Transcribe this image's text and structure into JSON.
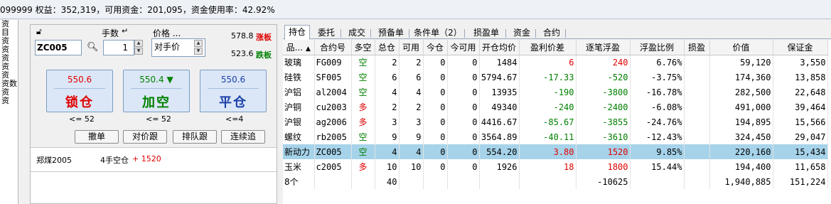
{
  "topbar": {
    "text": "099999 权益：352,319，可用资金：201,095，资金使用率：42.92%"
  },
  "left_strip": {
    "items": [
      "资",
      "",
      "目",
      "",
      "",
      "资",
      "资",
      "资",
      "资",
      "资",
      "资数",
      "资",
      "资"
    ]
  },
  "order": {
    "lot_label": "手数",
    "price_label": "价格 ...",
    "code": "ZC005",
    "qty": "1",
    "price_type": "对手价",
    "limit_up": {
      "value": "578.8",
      "label": "涨板"
    },
    "limit_down": {
      "value": "523.6",
      "label": "跌板"
    },
    "buttons": [
      {
        "price": "550.6",
        "title": "锁仓",
        "arrow": "",
        "price_color": "#e00000",
        "title_color": "#e00000",
        "under": "<= 52"
      },
      {
        "price": "550.4",
        "title": "加空",
        "arrow": "▼",
        "price_color": "#008000",
        "title_color": "#008000",
        "under": "<= 52"
      },
      {
        "price": "550.6",
        "title": "平仓",
        "arrow": "",
        "price_color": "#1a3fa8",
        "title_color": "#1a3fa8",
        "under": "<=4"
      }
    ],
    "actions": [
      "撤单",
      "对价跟",
      "排队跟",
      "连续追"
    ],
    "position_line": {
      "contract": "郑煤2005",
      "desc": "4手空仓",
      "pnl": "+ 1520"
    }
  },
  "tabs": [
    "持仓",
    "委托",
    "成交",
    "预备单",
    "条件单（2）",
    "损盈单",
    "资金",
    "合约"
  ],
  "active_tab": 0,
  "grid": {
    "headers": [
      "品...",
      "合约号",
      "多空",
      "总仓",
      "可用",
      "今仓",
      "今可用",
      "开仓均价",
      "盈利价差",
      "逐笔浮盈",
      "浮盈比例",
      "损盈",
      "价值",
      "保证金"
    ],
    "rows": [
      [
        "玻璃",
        "FG009",
        "空",
        "2",
        "2",
        "0",
        "0",
        "1484",
        "6",
        "240",
        "6.76%",
        "",
        "59,120",
        "3,550"
      ],
      [
        "硅铁",
        "SF005",
        "空",
        "6",
        "6",
        "0",
        "0",
        "5794.67",
        "-17.33",
        "-520",
        "-3.75%",
        "",
        "174,360",
        "13,858"
      ],
      [
        "沪铝",
        "al2004",
        "空",
        "4",
        "4",
        "0",
        "0",
        "13935",
        "-190",
        "-3800",
        "-16.78%",
        "",
        "282,500",
        "22,648"
      ],
      [
        "沪铜",
        "cu2003",
        "多",
        "2",
        "2",
        "0",
        "0",
        "49340",
        "-240",
        "-2400",
        "-6.08%",
        "",
        "491,000",
        "39,464"
      ],
      [
        "沪银",
        "ag2006",
        "多",
        "3",
        "3",
        "0",
        "0",
        "4416.67",
        "-85.67",
        "-3855",
        "-24.76%",
        "",
        "194,895",
        "15,566"
      ],
      [
        "螺纹",
        "rb2005",
        "空",
        "9",
        "9",
        "0",
        "0",
        "3564.89",
        "-40.11",
        "-3610",
        "-12.43%",
        "",
        "324,450",
        "29,047"
      ],
      [
        "新动力",
        "ZC005",
        "空",
        "4",
        "4",
        "0",
        "0",
        "554.20",
        "3.80",
        "1520",
        "9.85%",
        "",
        "220,160",
        "15,434"
      ],
      [
        "玉米",
        "c2005",
        "多",
        "10",
        "10",
        "0",
        "0",
        "1926",
        "18",
        "1800",
        "15.44%",
        "",
        "194,400",
        "11,658"
      ],
      [
        "8个",
        "",
        "",
        "40",
        "",
        "",
        "",
        "",
        "",
        "-10625",
        "",
        "",
        "1,940,885",
        "151,224"
      ]
    ],
    "selected_row": 6,
    "sort_arrow": "▲"
  }
}
